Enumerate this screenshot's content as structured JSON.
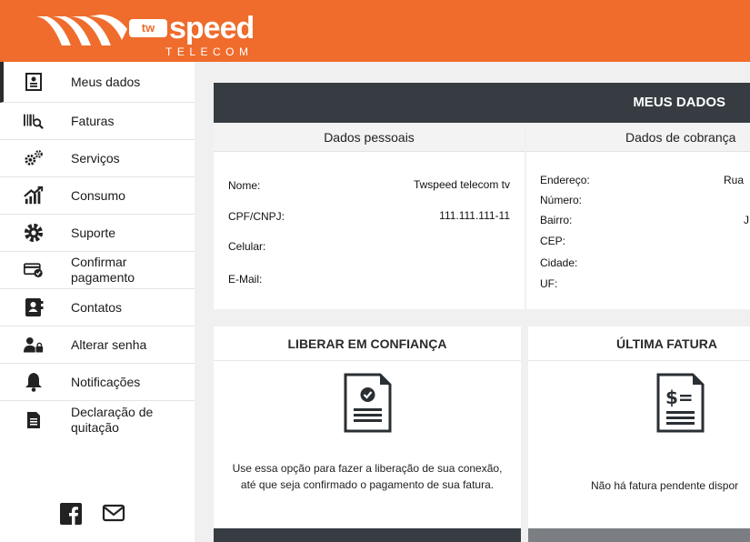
{
  "brand": {
    "badge": "tw",
    "word": "speed",
    "sub": "TELECOM"
  },
  "sidebar": {
    "items": [
      {
        "label": "Meus dados",
        "icon": "id-card-icon"
      },
      {
        "label": "Faturas",
        "icon": "barcode-search-icon"
      },
      {
        "label": "Serviços",
        "icon": "gears-icon"
      },
      {
        "label": "Consumo",
        "icon": "chart-up-icon"
      },
      {
        "label": "Suporte",
        "icon": "gear-support-icon"
      },
      {
        "label": "Confirmar pagamento",
        "icon": "card-check-icon"
      },
      {
        "label": "Contatos",
        "icon": "contact-book-icon"
      },
      {
        "label": "Alterar senha",
        "icon": "user-lock-icon"
      },
      {
        "label": "Notificações",
        "icon": "bell-icon"
      },
      {
        "label": "Declaração de quitação",
        "icon": "document-icon"
      }
    ],
    "social": [
      "facebook-icon",
      "mail-icon"
    ]
  },
  "main": {
    "title": "MEUS DADOS",
    "personal": {
      "heading": "Dados pessoais",
      "fields": [
        {
          "label": "Nome:",
          "value": "Twspeed telecom tv"
        },
        {
          "label": "CPF/CNPJ:",
          "value": "111.111.111-11"
        },
        {
          "label": "Celular:",
          "value": ""
        },
        {
          "label": "E-Mail:",
          "value": ""
        }
      ]
    },
    "billing": {
      "heading": "Dados de cobrança",
      "fields": [
        {
          "label": "Endereço:",
          "value": "Rua"
        },
        {
          "label": "Número:",
          "value": ""
        },
        {
          "label": "Bairro:",
          "value": "J"
        },
        {
          "label": "CEP:",
          "value": ""
        },
        {
          "label": "Cidade:",
          "value": ""
        },
        {
          "label": "UF:",
          "value": ""
        }
      ]
    },
    "trust": {
      "title": "LIBERAR EM CONFIANÇA",
      "text": "Use essa opção para fazer a liberação de sua conexão, até que seja confirmado o pagamento de sua fatura."
    },
    "invoice": {
      "title": "ÚLTIMA FATURA",
      "text": "Não há fatura pendente dispor"
    }
  },
  "colors": {
    "brand": "#ef6c2c",
    "dark": "#363c42"
  }
}
